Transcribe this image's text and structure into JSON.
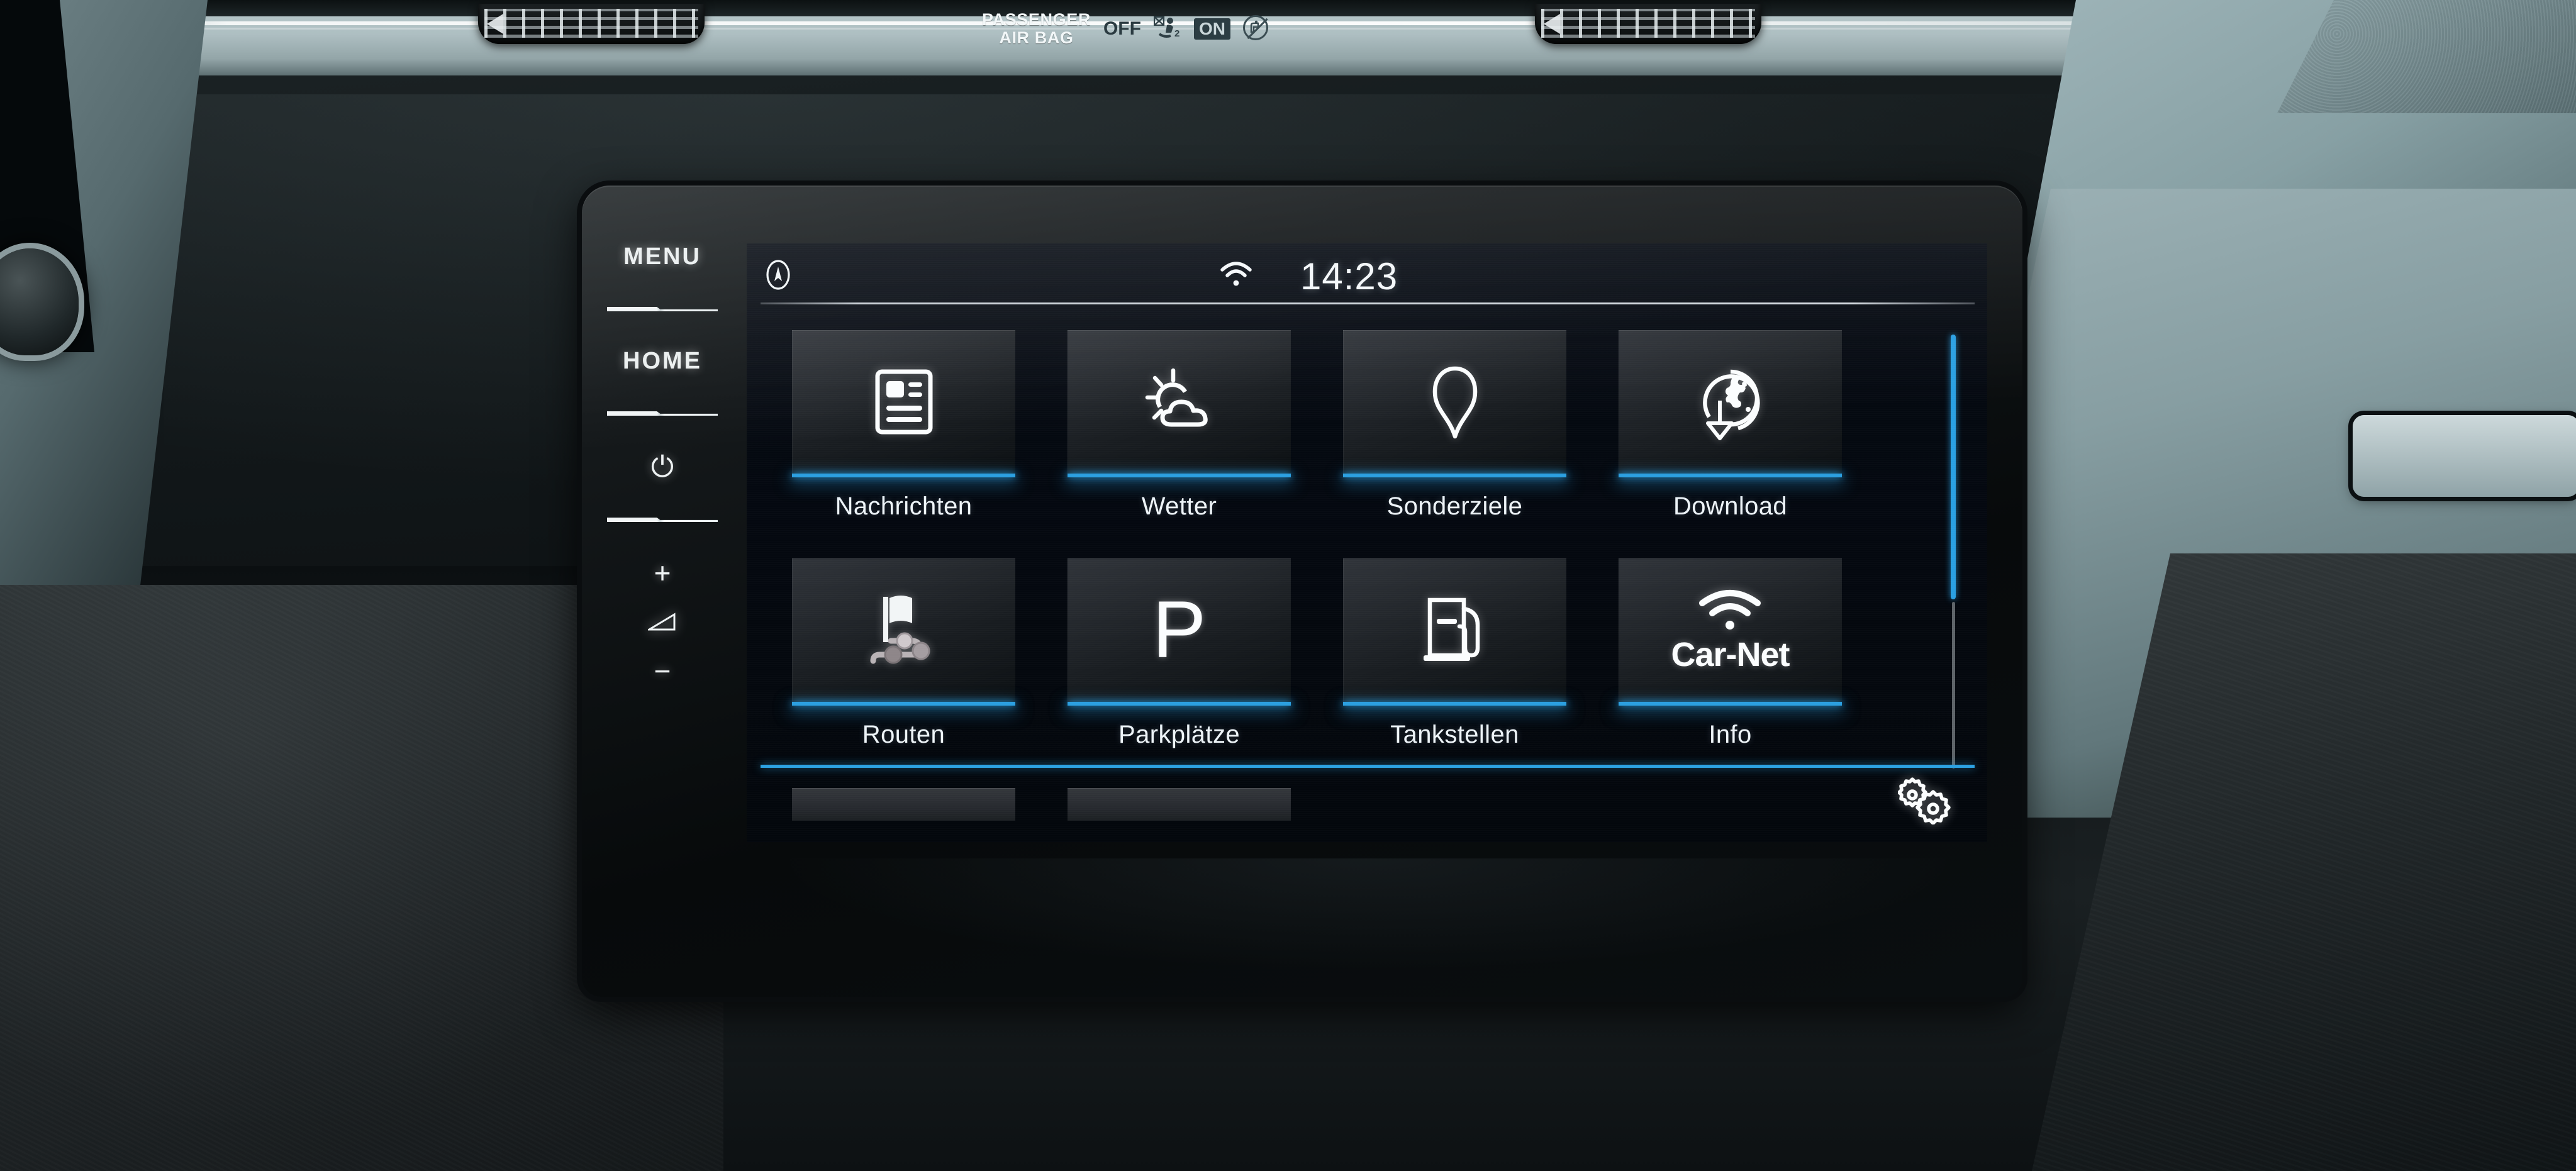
{
  "vehicle": {
    "airbag": {
      "title_line1": "PASSENGER",
      "title_line2": "AIR BAG",
      "off_label": "OFF",
      "on_label": "ON",
      "off_icon": "airbag-off-icon",
      "on_icon": "child-seat-prohibited-icon"
    },
    "vents": [
      {
        "name": "air-vent-left"
      },
      {
        "name": "air-vent-right"
      }
    ],
    "colors": {
      "dash_teal": "#8fa4a8",
      "dash_dark": "#141a1c"
    }
  },
  "head_unit": {
    "hardware_keys": [
      {
        "id": "menu",
        "label": "MENU",
        "type": "text"
      },
      {
        "id": "home",
        "label": "HOME",
        "type": "text"
      },
      {
        "id": "power",
        "label": "⏻",
        "type": "glyph",
        "icon": "power-icon"
      },
      {
        "id": "volup",
        "label": "+",
        "type": "glyph",
        "icon": "volume-up-icon"
      },
      {
        "id": "volume",
        "label": "",
        "type": "icon",
        "icon": "volume-icon"
      },
      {
        "id": "voldown",
        "label": "−",
        "type": "glyph",
        "icon": "volume-down-icon"
      }
    ]
  },
  "screen": {
    "status_bar": {
      "nav_icon": "compass-icon",
      "wifi_icon": "wifi-icon",
      "time": "14:23"
    },
    "accent_color": "#2b9fe0",
    "tiles": [
      {
        "label": "Nachrichten",
        "icon": "news-icon"
      },
      {
        "label": "Wetter",
        "icon": "sun-cloud-icon"
      },
      {
        "label": "Sonderziele",
        "icon": "map-pin-icon"
      },
      {
        "label": "Download",
        "icon": "globe-download-icon"
      },
      {
        "label": "Routen",
        "icon": "route-flag-icon"
      },
      {
        "label": "Parkplätze",
        "icon": "parking-p-icon",
        "glyph": "P"
      },
      {
        "label": "Tankstellen",
        "icon": "fuel-pump-icon"
      },
      {
        "label": "Info",
        "icon": "carnet-wifi-icon",
        "glyph": "Car-Net"
      }
    ],
    "partial_row_tiles": [
      {
        "name": "tile-partial-1"
      },
      {
        "name": "tile-partial-2"
      }
    ],
    "scrollbar": {
      "thumb_percent": 61,
      "thumb_color": "#29a0e3",
      "track_color": "#5d6368"
    },
    "bottom_bar": {
      "settings_icon": "settings-gears-icon"
    }
  }
}
